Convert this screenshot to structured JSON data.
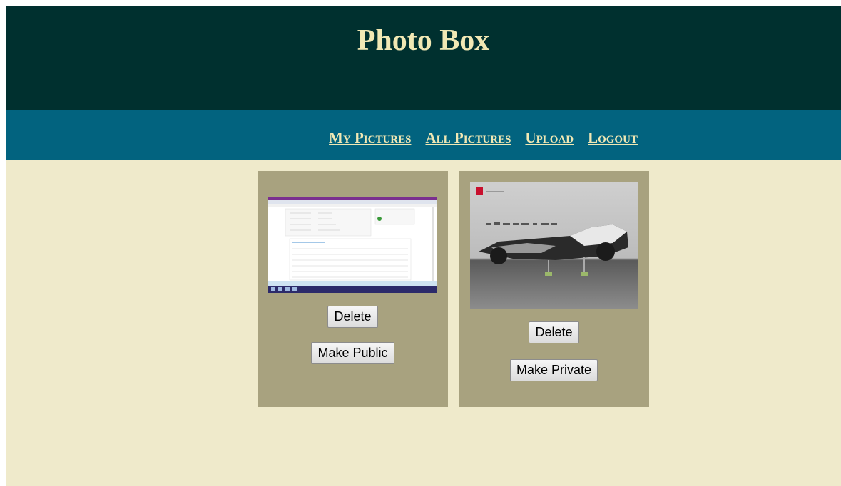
{
  "header": {
    "title": "Photo Box"
  },
  "nav": {
    "items": [
      "My Pictures",
      "All Pictures",
      "Upload",
      "Logout"
    ]
  },
  "photos": [
    {
      "delete_label": "Delete",
      "toggle_label": "Make Public"
    },
    {
      "delete_label": "Delete",
      "toggle_label": "Make Private"
    }
  ],
  "colors": {
    "header_bg": "#00302f",
    "nav_bg": "#02637f",
    "page_bg": "#efeacb",
    "card_bg": "#a8a27f",
    "title_text": "#f1e8b4"
  }
}
